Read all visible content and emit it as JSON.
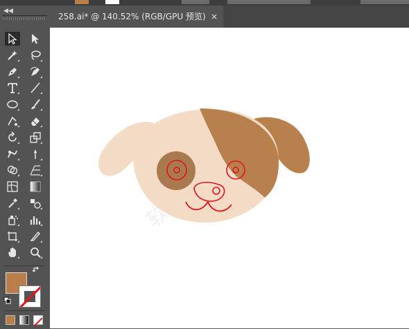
{
  "colors": {
    "ui_dark": "#535353",
    "accent": "#b97e4c",
    "canvas": "#ffffff",
    "dog_face": "#f3dbc6",
    "dog_brown": "#b8804c",
    "eye_patch": "#a97a50",
    "stroke_red": "#e0141b"
  },
  "topbar": {
    "collapse_label": "◀◀"
  },
  "document_tab": {
    "title": "258.ai* @ 140.52% (RGB/GPU 预览)",
    "close_label": "×"
  },
  "tools": [
    {
      "name": "selection-tool-icon",
      "active": true
    },
    {
      "name": "direct-selection-tool-icon"
    },
    {
      "name": "magic-wand-tool-icon"
    },
    {
      "name": "lasso-tool-icon"
    },
    {
      "name": "pen-tool-icon"
    },
    {
      "name": "curvature-tool-icon"
    },
    {
      "name": "type-tool-icon"
    },
    {
      "name": "line-segment-tool-icon"
    },
    {
      "name": "ellipse-tool-icon"
    },
    {
      "name": "paintbrush-tool-icon"
    },
    {
      "name": "shaper-tool-icon"
    },
    {
      "name": "eraser-tool-icon"
    },
    {
      "name": "rotate-tool-icon"
    },
    {
      "name": "scale-tool-icon"
    },
    {
      "name": "warp-tool-icon"
    },
    {
      "name": "puppet-warp-tool-icon"
    },
    {
      "name": "shape-builder-tool-icon"
    },
    {
      "name": "perspective-grid-tool-icon"
    },
    {
      "name": "mesh-tool-icon"
    },
    {
      "name": "gradient-tool-icon"
    },
    {
      "name": "eyedropper-tool-icon"
    },
    {
      "name": "blend-tool-icon"
    },
    {
      "name": "symbol-sprayer-tool-icon"
    },
    {
      "name": "column-graph-tool-icon"
    },
    {
      "name": "artboard-tool-icon"
    },
    {
      "name": "slice-tool-icon"
    },
    {
      "name": "hand-tool-icon"
    },
    {
      "name": "zoom-tool-icon"
    }
  ],
  "swatches": {
    "fill_color": "#b97e4c",
    "stroke_state": "none"
  },
  "watermark_text": "软件自学网"
}
